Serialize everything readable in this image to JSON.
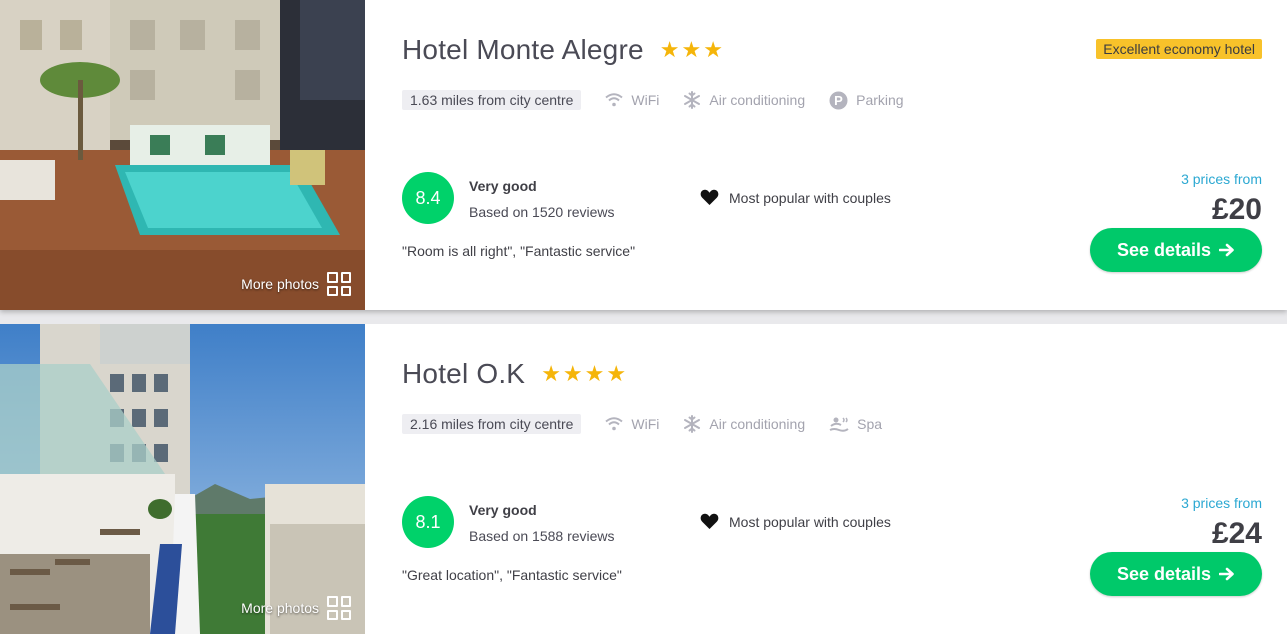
{
  "colors": {
    "accent_green": "#00c96a",
    "score_green": "#00d26a",
    "star": "#f5b50a",
    "badge": "#f8c22a",
    "price_link": "#2ba8d2"
  },
  "hotels": [
    {
      "name": "Hotel Monte Alegre",
      "stars": 3,
      "badge": "Excellent economy hotel",
      "distance": "1.63 miles from city centre",
      "amenities": [
        {
          "icon": "wifi-icon",
          "label": "WiFi"
        },
        {
          "icon": "snowflake-icon",
          "label": "Air conditioning"
        },
        {
          "icon": "parking-icon",
          "label": "Parking"
        }
      ],
      "score": "8.4",
      "rating_label": "Very good",
      "reviews": "Based on 1520 reviews",
      "popular": "Most popular with couples",
      "quote": "\"Room is all right\", \"Fantastic service\"",
      "prices_from": "3 prices from",
      "price": "£20",
      "button": "See details",
      "more_photos": "More photos"
    },
    {
      "name": "Hotel O.K",
      "stars": 4,
      "badge": "",
      "distance": "2.16 miles from city centre",
      "amenities": [
        {
          "icon": "wifi-icon",
          "label": "WiFi"
        },
        {
          "icon": "snowflake-icon",
          "label": "Air conditioning"
        },
        {
          "icon": "spa-icon",
          "label": "Spa"
        }
      ],
      "score": "8.1",
      "rating_label": "Very good",
      "reviews": "Based on 1588 reviews",
      "popular": "Most popular with couples",
      "quote": "\"Great location\", \"Fantastic service\"",
      "prices_from": "3 prices from",
      "price": "£24",
      "button": "See details",
      "more_photos": "More photos"
    }
  ]
}
